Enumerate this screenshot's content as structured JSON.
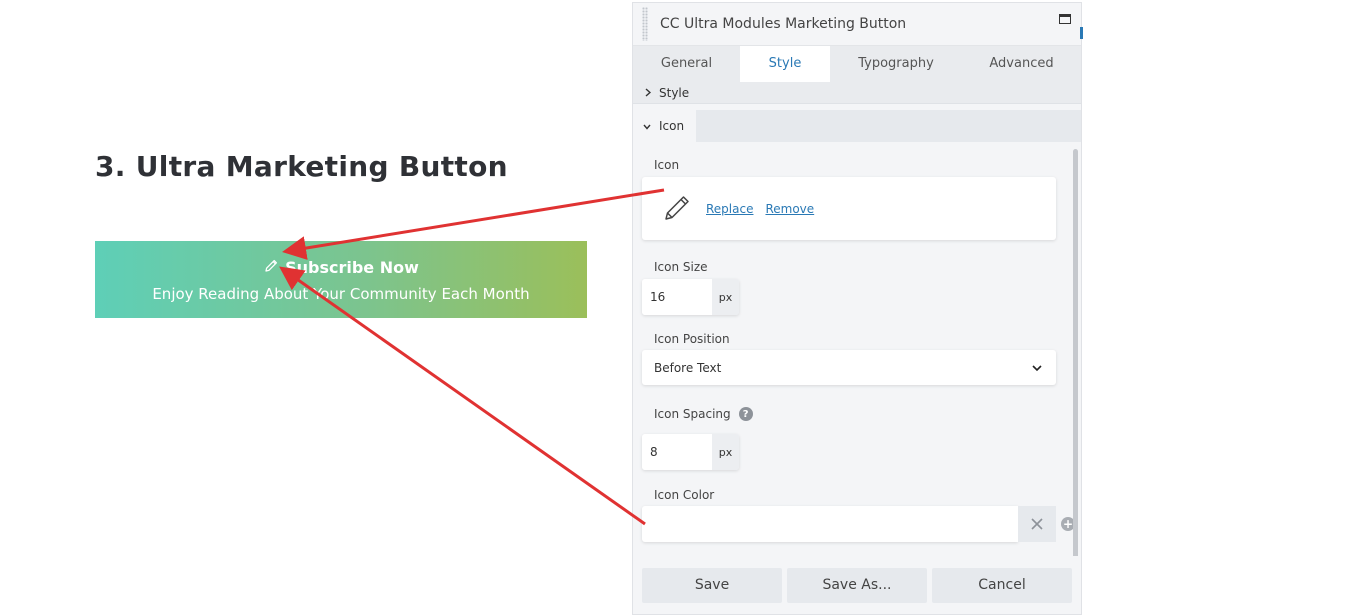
{
  "content": {
    "heading": "3. Ultra Marketing Button",
    "button_title": "Subscribe Now",
    "button_subtitle": "Enjoy Reading About Your Community Each Month",
    "gradient_colors": [
      "#5ecfb7",
      "#9bbf5a"
    ]
  },
  "panel": {
    "title": "CC Ultra Modules Marketing Button",
    "tabs": [
      {
        "label": "General",
        "active": false
      },
      {
        "label": "Style",
        "active": true
      },
      {
        "label": "Typography",
        "active": false
      },
      {
        "label": "Advanced",
        "active": false
      }
    ],
    "breadcrumb": "Style",
    "section": "Icon",
    "icon_label": "Icon",
    "icon_name": "pencil-icon",
    "replace_link": "Replace",
    "remove_link": "Remove",
    "icon_size_label": "Icon Size",
    "icon_size_value": "16",
    "icon_size_unit": "px",
    "icon_position_label": "Icon Position",
    "icon_position_value": "Before Text",
    "icon_spacing_label": "Icon Spacing",
    "icon_spacing_value": "8",
    "icon_spacing_unit": "px",
    "icon_color_label": "Icon Color",
    "icon_color_value": "",
    "save": "Save",
    "save_as": "Save As...",
    "cancel": "Cancel",
    "accent_color": "#2a79b5",
    "annotation_color": "#e03232"
  }
}
